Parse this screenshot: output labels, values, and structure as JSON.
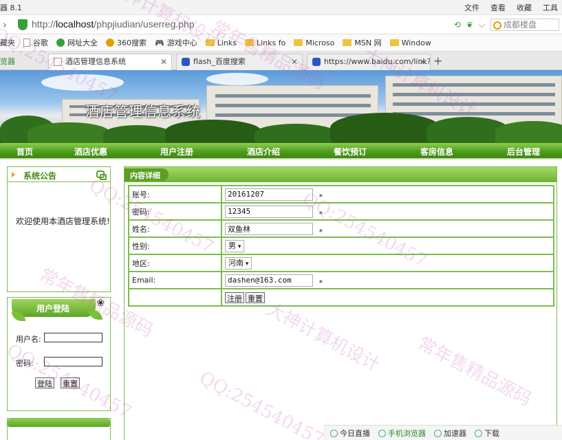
{
  "browser": {
    "app_title": "器 8.1",
    "menus": [
      "文件",
      "查看",
      "收藏",
      "工具"
    ],
    "url_prefix": "http://",
    "url_host": "localhost",
    "url_path": "/phpjiudian/userreg.php",
    "search_placeholder": "成都楼盘",
    "bookmarks": [
      "藏夹",
      "谷歌",
      "网址大全",
      "360搜索",
      "游戏中心",
      "Links",
      "Links fo",
      "Microso",
      "MSN 网",
      "Window"
    ],
    "tab_side_label": "览器",
    "tabs": [
      "酒店管理信息系统",
      "flash_百度搜索",
      "https://www.baidu.com/link?u"
    ]
  },
  "site": {
    "banner_title": "酒店管理信息系统",
    "nav": [
      "首页",
      "酒店优惠",
      "用户注册",
      "酒店介绍",
      "餐饮预订",
      "客房信息",
      "后台管理"
    ]
  },
  "sidebar": {
    "notice_title": "系统公告",
    "notice_text": "欢迎使用本酒店管理系统!",
    "login_title": "用户登陆",
    "username_label": "用户名:",
    "password_label": "密码:",
    "login_button": "登陆",
    "reset_button": "重置"
  },
  "content": {
    "title": "内容详细",
    "form": {
      "account_label": "账号:",
      "account_value": "20161207",
      "password_label": "密码:",
      "password_value": "12345",
      "name_label": "姓名:",
      "name_value": "双鱼林",
      "gender_label": "性别:",
      "gender_value": "男",
      "region_label": "地区:",
      "region_value": "河南",
      "email_label": "Email:",
      "email_value": "dashen@163.com",
      "required_mark": "*",
      "register_button": "注册",
      "reset_button": "重置"
    }
  },
  "statusbar": [
    "今日直播",
    "手机浏览器",
    "加速器",
    "下载"
  ],
  "watermarks": [
    "大神计算机设计",
    "常年售精品源码",
    "QQ:254540457"
  ],
  "colors": {
    "nav_green": "#4f9e1e",
    "border_green": "#7cbc4c"
  }
}
